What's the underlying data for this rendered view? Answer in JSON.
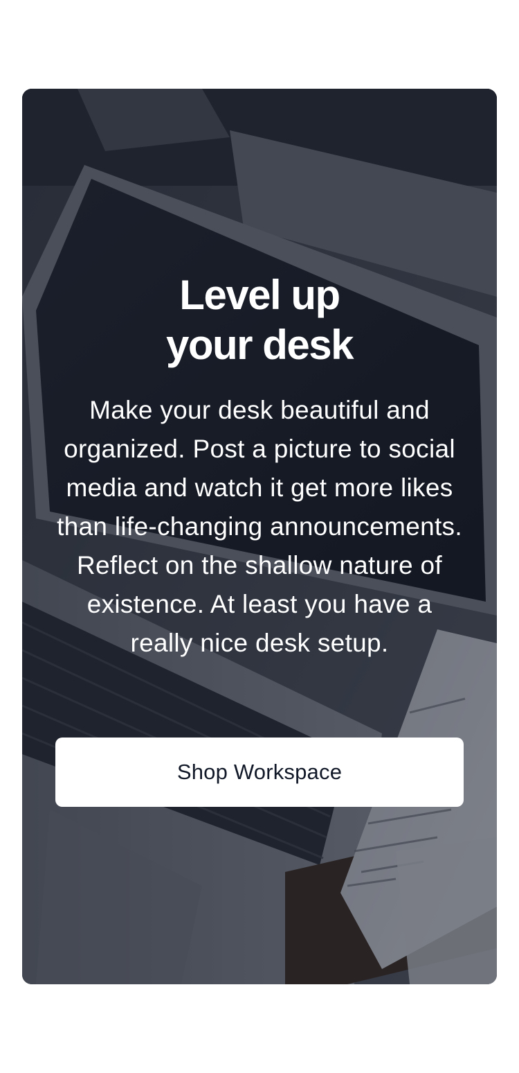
{
  "hero": {
    "title": "Level up\nyour desk",
    "description": "Make your desk beautiful and organized. Post a picture to social media and watch it get more likes than life-changing announcements. Reflect on the shallow nature of existence. At least you have a really nice desk setup.",
    "button_label": "Shop Workspace",
    "background_image": "laptop-and-desk-card-photo",
    "colors": {
      "overlay": "#111827",
      "button_bg": "#ffffff",
      "button_text": "#111827",
      "text": "#ffffff"
    }
  }
}
